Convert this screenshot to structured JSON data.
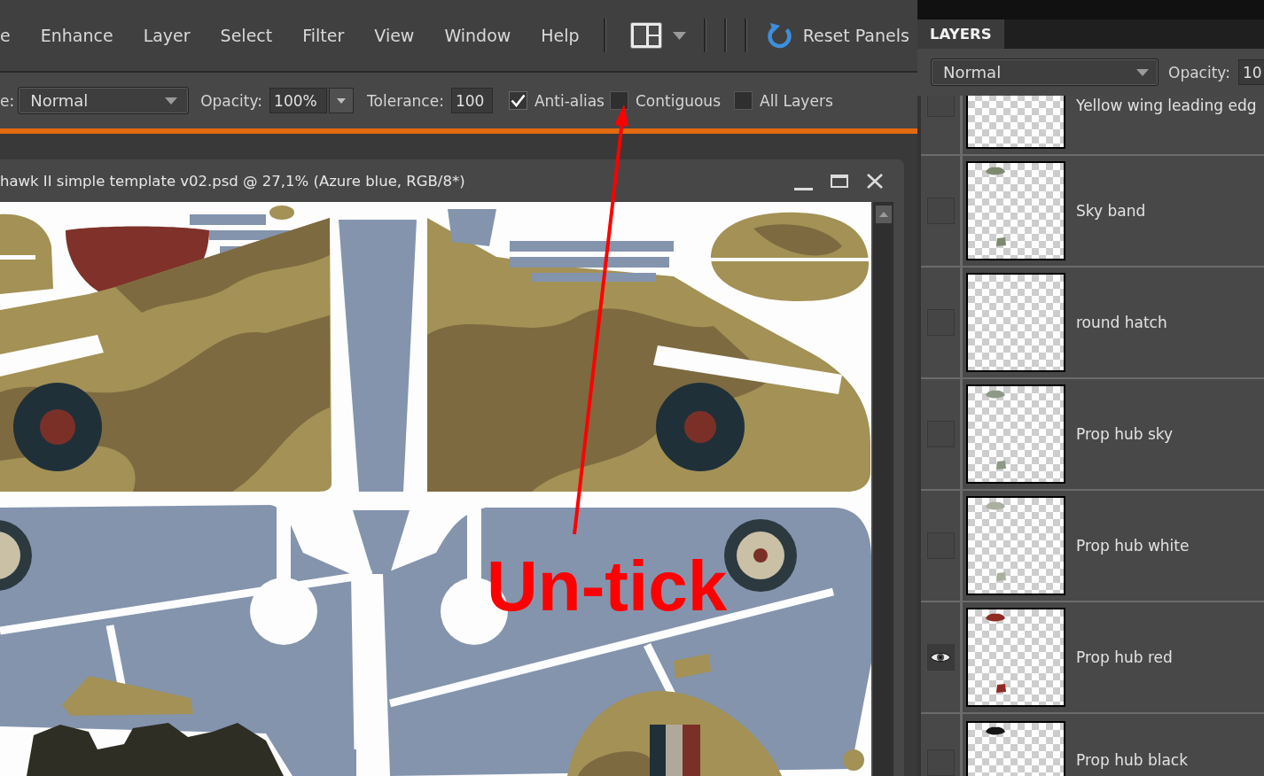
{
  "menu_bar": {
    "items": [
      "e",
      "Enhance",
      "Layer",
      "Select",
      "Filter",
      "View",
      "Window",
      "Help"
    ],
    "reset_button": "Reset Panels"
  },
  "options_bar": {
    "mode_label": "e:",
    "mode_value": "Normal",
    "opacity_label": "Opacity:",
    "opacity_value": "100%",
    "tolerance_label": "Tolerance:",
    "tolerance_value": "100",
    "checkboxes": [
      {
        "label": "Anti-alias",
        "checked": true
      },
      {
        "label": "Contiguous",
        "checked": false
      },
      {
        "label": "All Layers",
        "checked": false
      }
    ]
  },
  "document": {
    "title": "hawk II simple template v02.psd @ 27,1% (Azure blue, RGB/8*)"
  },
  "annotation": {
    "label": "Un-tick"
  },
  "layers_panel": {
    "tabs": [
      {
        "label": "LAYERS",
        "selected": true
      }
    ],
    "blend_mode": "Normal",
    "opacity_label": "Opacity:",
    "opacity_value": "10",
    "layers": [
      {
        "name": "Yellow wing leading edg",
        "visible": false
      },
      {
        "name": "Sky band",
        "visible": false,
        "color": "#7d8a70"
      },
      {
        "name": "round hatch",
        "visible": false
      },
      {
        "name": "Prop hub sky",
        "visible": false,
        "color": "#8d9a88"
      },
      {
        "name": "Prop hub white",
        "visible": false,
        "color": "#a9b0a0"
      },
      {
        "name": "Prop hub red",
        "visible": true,
        "color": "#8e2b22"
      },
      {
        "name": "Prop hub black",
        "visible": false,
        "color": "#151515"
      }
    ]
  }
}
